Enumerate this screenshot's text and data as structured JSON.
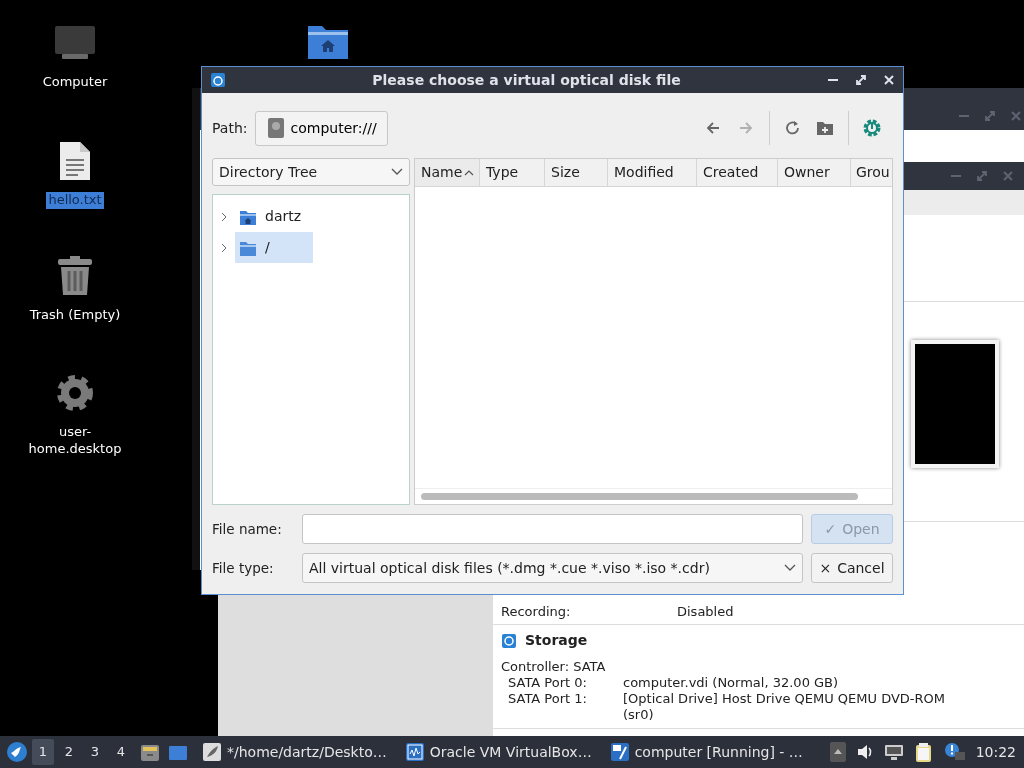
{
  "desktop_icons": [
    {
      "label": "Computer",
      "kind": "computer",
      "selected": false
    },
    {
      "label": "hello.txt",
      "kind": "text-file",
      "selected": true
    },
    {
      "label": "Trash (Empty)",
      "kind": "trash",
      "selected": false
    },
    {
      "label": "user-home.desktop",
      "kind": "gear",
      "selected": false
    },
    {
      "kind": "home-folder"
    }
  ],
  "vm_details": {
    "rows": [
      {
        "label": "Recording:",
        "value": "Disabled"
      }
    ],
    "storage": {
      "title": "Storage",
      "controller": "Controller: SATA",
      "ports": [
        {
          "label": "SATA Port 0:",
          "value": "computer.vdi (Normal, 32.00 GB)"
        },
        {
          "label": "SATA Port 1:",
          "value": "[Optical Drive] Host Drive QEMU QEMU DVD-ROM (sr0)"
        }
      ]
    }
  },
  "dialog": {
    "title": "Please choose a virtual optical disk file",
    "path_label": "Path:",
    "path": "computer:///",
    "toolbar": [
      {
        "kind": "back",
        "disabled": false
      },
      {
        "kind": "forward",
        "disabled": true
      },
      {
        "kind": "refresh",
        "disabled": false
      },
      {
        "kind": "new-folder",
        "disabled": false
      },
      {
        "kind": "settings",
        "disabled": false
      }
    ],
    "view": "Directory Tree",
    "tree": [
      {
        "label": "dartz",
        "kind": "home",
        "expanded": false,
        "selected": false
      },
      {
        "label": "/",
        "kind": "folder",
        "expanded": false,
        "selected": true
      }
    ],
    "columns": [
      {
        "label": "Name",
        "sorted": true
      },
      {
        "label": "Type"
      },
      {
        "label": "Size"
      },
      {
        "label": "Modified"
      },
      {
        "label": "Created"
      },
      {
        "label": "Owner"
      },
      {
        "label": "Grou"
      }
    ],
    "file_name_label": "File name:",
    "file_type_label": "File type:",
    "file_type": "All virtual optical disk files (*.dmg *.cue *.viso *.iso *.cdr)",
    "buttons": [
      {
        "label": "Open",
        "icon": "✓",
        "disabled": true
      },
      {
        "label": "Cancel",
        "icon": "×",
        "disabled": false
      }
    ]
  },
  "taskbar": {
    "workspaces": [
      {
        "label": "1",
        "selected": true
      },
      {
        "label": "2",
        "selected": false
      },
      {
        "label": "3",
        "selected": false
      },
      {
        "label": "4",
        "selected": false
      }
    ],
    "launchers": [
      {
        "kind": "file-manager"
      },
      {
        "kind": "desktop"
      }
    ],
    "tasks": [
      {
        "label": "*/home/dartz/Deskto…",
        "kind": "editor"
      },
      {
        "label": "Oracle VM VirtualBox…",
        "kind": "virtualbox"
      },
      {
        "label": "computer [Running] - …",
        "kind": "vm"
      }
    ],
    "tray": [
      {
        "kind": "expand"
      },
      {
        "kind": "volume"
      },
      {
        "kind": "network"
      },
      {
        "kind": "clipboard"
      },
      {
        "kind": "notification"
      }
    ],
    "clock": "10:22"
  }
}
